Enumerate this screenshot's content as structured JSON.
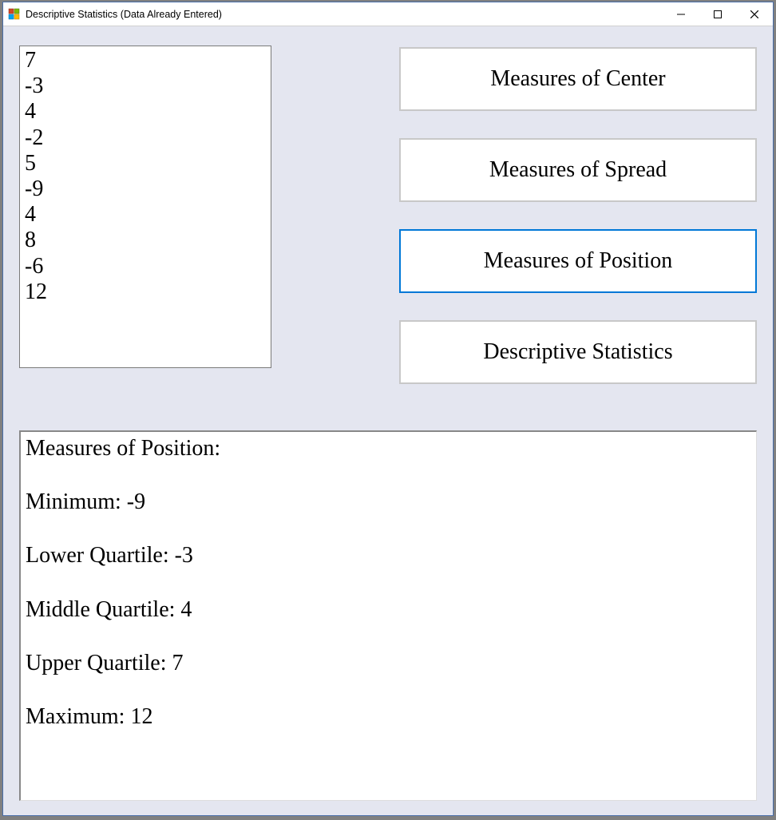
{
  "window": {
    "title": "Descriptive Statistics (Data Already Entered)"
  },
  "data_values": [
    "7",
    "-3",
    "4",
    "-2",
    "5",
    "-9",
    "4",
    "8",
    "-6",
    "12"
  ],
  "buttons": {
    "center": "Measures of Center",
    "spread": "Measures of Spread",
    "position": "Measures of Position",
    "descriptive": "Descriptive Statistics"
  },
  "output": {
    "heading": "Measures of Position:",
    "lines": [
      "Minimum: -9",
      "Lower Quartile: -3",
      "Middle Quartile: 4",
      "Upper Quartile: 7",
      "Maximum: 12"
    ]
  }
}
